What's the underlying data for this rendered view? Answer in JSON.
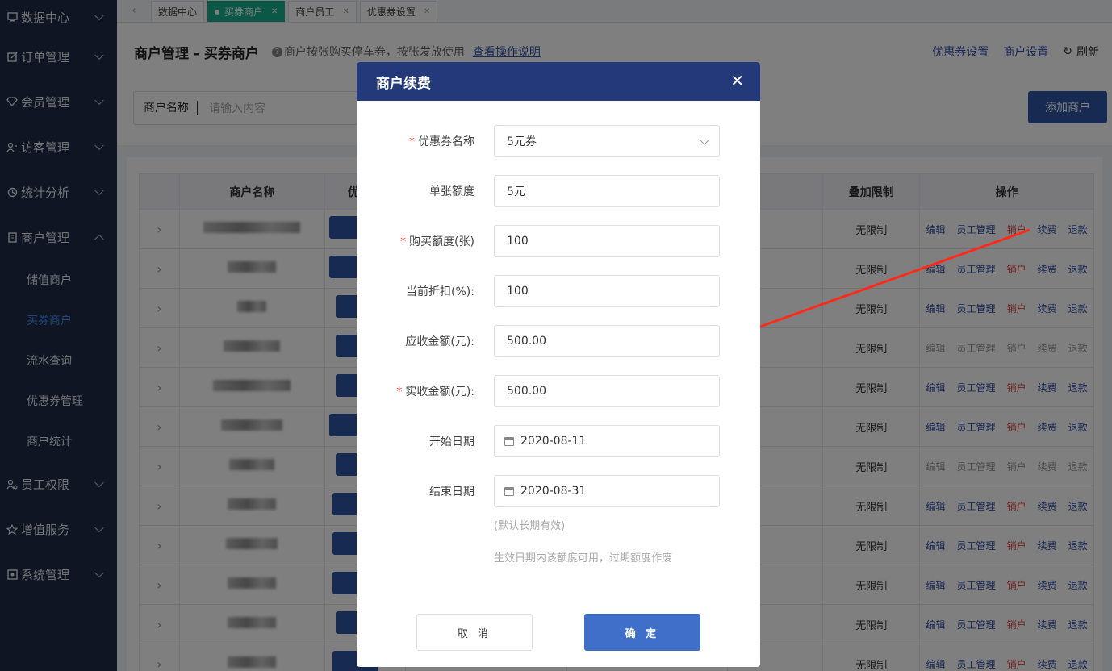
{
  "sidebar": {
    "items": [
      {
        "label": "数据中心",
        "icon": "monitor-icon"
      },
      {
        "label": "订单管理",
        "icon": "edit-icon"
      },
      {
        "label": "会员管理",
        "icon": "diamond-icon"
      },
      {
        "label": "访客管理",
        "icon": "visitor-icon"
      },
      {
        "label": "统计分析",
        "icon": "clock-icon"
      },
      {
        "label": "商户管理",
        "icon": "building-icon"
      },
      {
        "label": "员工权限",
        "icon": "user-icon"
      },
      {
        "label": "增值服务",
        "icon": "star-icon"
      },
      {
        "label": "系统管理",
        "icon": "settings-icon"
      }
    ],
    "sub_items": [
      "储值商户",
      "买券商户",
      "流水查询",
      "优惠券管理",
      "商户统计"
    ]
  },
  "tabs": [
    {
      "label": "数据中心",
      "active": false,
      "closable": false
    },
    {
      "label": "买券商户",
      "active": true,
      "closable": true
    },
    {
      "label": "商户员工",
      "active": false,
      "closable": true
    },
    {
      "label": "优惠券设置",
      "active": false,
      "closable": true
    }
  ],
  "header": {
    "title": "商户管理 - 买券商户",
    "hint": "商户按张购买停车券，按张发放使用",
    "help_link": "查看操作说明",
    "links": [
      "优惠券设置",
      "商户设置"
    ],
    "refresh": "刷新"
  },
  "filter": {
    "label": "商户名称",
    "placeholder": "请输入内容"
  },
  "add_button": "添加商户",
  "table": {
    "headers": [
      "",
      "商户名称",
      "优惠",
      "",
      "",
      "",
      "叠加限制",
      "操作"
    ],
    "limit_value": "无限制",
    "ops": [
      "编辑",
      "员工管理",
      "销户",
      "续费",
      "退款"
    ],
    "row_count": 12
  },
  "modal": {
    "title": "商户续费",
    "fields": [
      {
        "label": "优惠券名称",
        "required": true,
        "value": "5元券",
        "type": "select"
      },
      {
        "label": "单张额度",
        "required": false,
        "value": "5元",
        "type": "text"
      },
      {
        "label": "购买额度(张)",
        "required": true,
        "value": "100",
        "type": "text"
      },
      {
        "label": "当前折扣(%):",
        "required": false,
        "value": "100",
        "type": "text"
      },
      {
        "label": "应收金额(元):",
        "required": false,
        "value": "500.00",
        "type": "text"
      },
      {
        "label": "实收金额(元):",
        "required": true,
        "value": "500.00",
        "type": "text"
      },
      {
        "label": "开始日期",
        "required": false,
        "value": "2020-08-11",
        "type": "date"
      },
      {
        "label": "结束日期",
        "required": false,
        "value": "2020-08-31",
        "type": "date"
      }
    ],
    "note1": "(默认长期有效)",
    "note2": "生效日期内该额度可用，过期额度作废",
    "cancel": "取 消",
    "confirm": "确 定"
  },
  "colors": {
    "sidebar": "#1f2a44",
    "accent": "#2f55a4",
    "modal_header": "#23397a",
    "active_tab": "#19b18d",
    "danger": "#e04343"
  }
}
